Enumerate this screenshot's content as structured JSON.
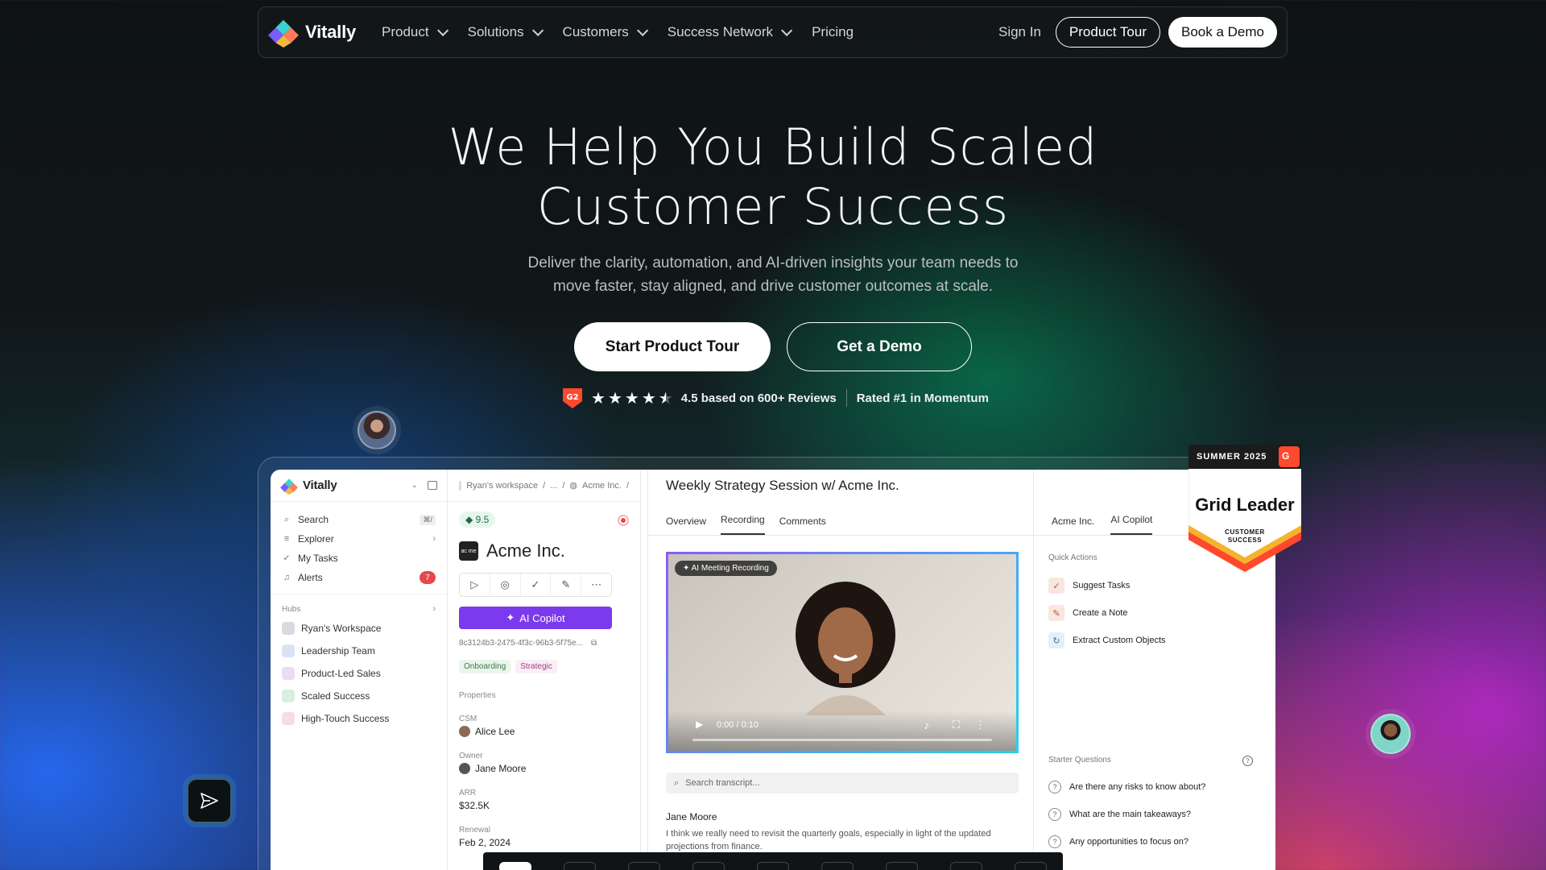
{
  "brand": {
    "name": "Vitally"
  },
  "nav": {
    "links": [
      {
        "label": "Product",
        "dropdown": true
      },
      {
        "label": "Solutions",
        "dropdown": true
      },
      {
        "label": "Customers",
        "dropdown": true
      },
      {
        "label": "Success Network",
        "dropdown": true
      },
      {
        "label": "Pricing",
        "dropdown": false
      }
    ],
    "sign_in": "Sign In",
    "product_tour": "Product Tour",
    "book_demo": "Book a Demo"
  },
  "hero": {
    "title_line1": "We Help You Build Scaled",
    "title_line2": "Customer Success",
    "subtitle_line1": "Deliver the clarity, automation, and AI-driven insights your team needs to",
    "subtitle_line2": "move faster, stay aligned, and drive customer outcomes at scale.",
    "cta_primary": "Start Product Tour",
    "cta_secondary": "Get a Demo",
    "rating_stars": 4.5,
    "rating_text": "4.5 based on 600+ Reviews",
    "rated_text": "Rated #1 in Momentum"
  },
  "award": {
    "season": "SUMMER 2025",
    "title": "Grid Leader",
    "category_line1": "CUSTOMER",
    "category_line2": "SUCCESS"
  },
  "app": {
    "brand": "Vitally",
    "sidebar": {
      "items": [
        {
          "label": "Search",
          "icon": "search-icon",
          "shortcut": "⌘/"
        },
        {
          "label": "Explorer",
          "icon": "database-icon"
        },
        {
          "label": "My Tasks",
          "icon": "checkmark-icon"
        },
        {
          "label": "Alerts",
          "icon": "bell-icon",
          "count": "7"
        }
      ],
      "hubs_label": "Hubs",
      "hubs": [
        {
          "label": "Ryan's Workspace",
          "color": "#d9d9e0"
        },
        {
          "label": "Leadership Team",
          "color": "#dbe3f2"
        },
        {
          "label": "Product-Led Sales",
          "color": "#eadcf5"
        },
        {
          "label": "Scaled Success",
          "color": "#d8efe2"
        },
        {
          "label": "High-Touch Success",
          "color": "#f7dce6"
        }
      ]
    },
    "account": {
      "breadcrumb_workspace": "Ryan's workspace",
      "breadcrumb_sep": "/",
      "breadcrumb_ellipsis": "...",
      "breadcrumb_current": "Acme Inc.",
      "health_score": "9.5",
      "logo_text": "ac me",
      "name": "Acme Inc.",
      "copilot_button": "AI Copilot",
      "uuid": "8c3124b3-2475-4f3c-96b3-5f75e...",
      "tags": [
        "Onboarding",
        "Strategic"
      ],
      "properties_label": "Properties",
      "properties": [
        {
          "label": "CSM",
          "value": "Alice Lee"
        },
        {
          "label": "Owner",
          "value": "Jane Moore"
        },
        {
          "label": "ARR",
          "value": "$32.5K"
        },
        {
          "label": "Renewal",
          "value": "Feb 2, 2024"
        }
      ]
    },
    "meeting": {
      "title": "Weekly Strategy Session w/ Acme Inc.",
      "tabs": [
        "Overview",
        "Recording",
        "Comments"
      ],
      "active_tab": "Recording",
      "recording_pill": "AI Meeting Recording",
      "video_time": "0:00 / 0:10",
      "transcript_search_placeholder": "Search transcript...",
      "speaker": "Jane Moore",
      "transcript": "I think we really need to revisit the quarterly goals, especially in light of the updated projections from finance."
    },
    "copilot": {
      "tabs": [
        "Acme Inc.",
        "AI Copilot"
      ],
      "active_tab": "AI Copilot",
      "quick_actions_label": "Quick Actions",
      "quick_actions": [
        {
          "label": "Suggest Tasks",
          "color": "#f8e6e0"
        },
        {
          "label": "Create a Note",
          "color": "#f8e6e0"
        },
        {
          "label": "Extract Custom Objects",
          "color": "#e3f0f5"
        }
      ],
      "starter_label": "Starter Questions",
      "starter_questions": [
        "Are there any risks to know about?",
        "What are the main takeaways?",
        "Any opportunities to focus on?"
      ]
    }
  },
  "colors": {
    "accent_purple": "#7c3aed",
    "alert_red": "#e5484d",
    "g2_red": "#ff492c"
  }
}
